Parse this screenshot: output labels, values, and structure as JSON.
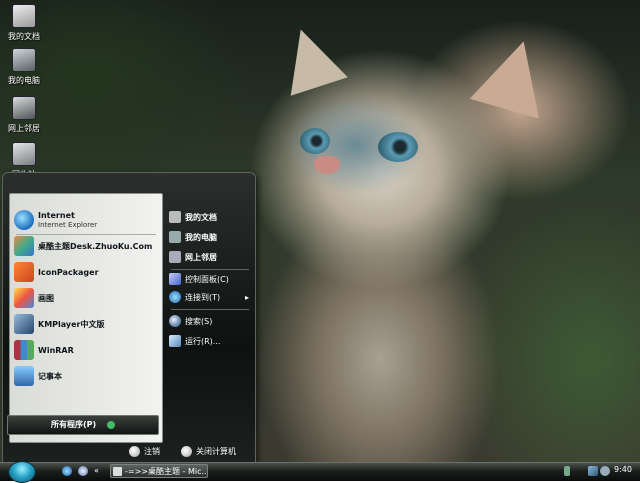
{
  "desktop": {
    "icons": [
      {
        "label": "我的文档",
        "icon": "my-documents-icon"
      },
      {
        "label": "我的电脑",
        "icon": "my-computer-icon"
      },
      {
        "label": "网上邻居",
        "icon": "network-icon"
      },
      {
        "label": "回收站",
        "icon": "recycle-bin-icon"
      }
    ]
  },
  "start_menu": {
    "programs": [
      {
        "title": "Internet",
        "subtitle": "Internet Explorer",
        "icon": "internet-explorer-icon"
      },
      {
        "title": "桌酷主题Desk.ZhuoKu.Com",
        "icon": "zhuoku-theme-icon"
      },
      {
        "title": "IconPackager",
        "icon": "iconpackager-icon"
      },
      {
        "title": "画图",
        "icon": "paint-icon"
      },
      {
        "title": "KMPlayer中文版",
        "icon": "kmplayer-icon"
      },
      {
        "title": "WinRAR",
        "icon": "winrar-icon"
      },
      {
        "title": "记事本",
        "icon": "notepad-icon"
      }
    ],
    "all_programs": "所有程序(P)",
    "places": [
      {
        "label": "我的文档",
        "icon": "my-documents-icon"
      },
      {
        "label": "我的电脑",
        "icon": "my-computer-icon"
      },
      {
        "label": "网上邻居",
        "icon": "network-icon"
      }
    ],
    "settings": [
      {
        "label": "控制面板(C)",
        "icon": "control-panel-icon"
      },
      {
        "label": "连接到(T)",
        "icon": "connect-to-icon",
        "arrow": "▸"
      }
    ],
    "tools": [
      {
        "label": "搜索(S)",
        "icon": "search-icon"
      },
      {
        "label": "运行(R)...",
        "icon": "run-icon"
      }
    ],
    "logoff": "注销",
    "shutdown": "关闭计算机"
  },
  "taskbar": {
    "active_window": "-=>>桌酷主题 - Mic...",
    "clock": "9:40",
    "chevron": "«"
  },
  "colors": {
    "taskbar_dark": "#0a0c0b",
    "start_orb": "#2aa5c9",
    "menu_panel": "#f2f3f0"
  }
}
